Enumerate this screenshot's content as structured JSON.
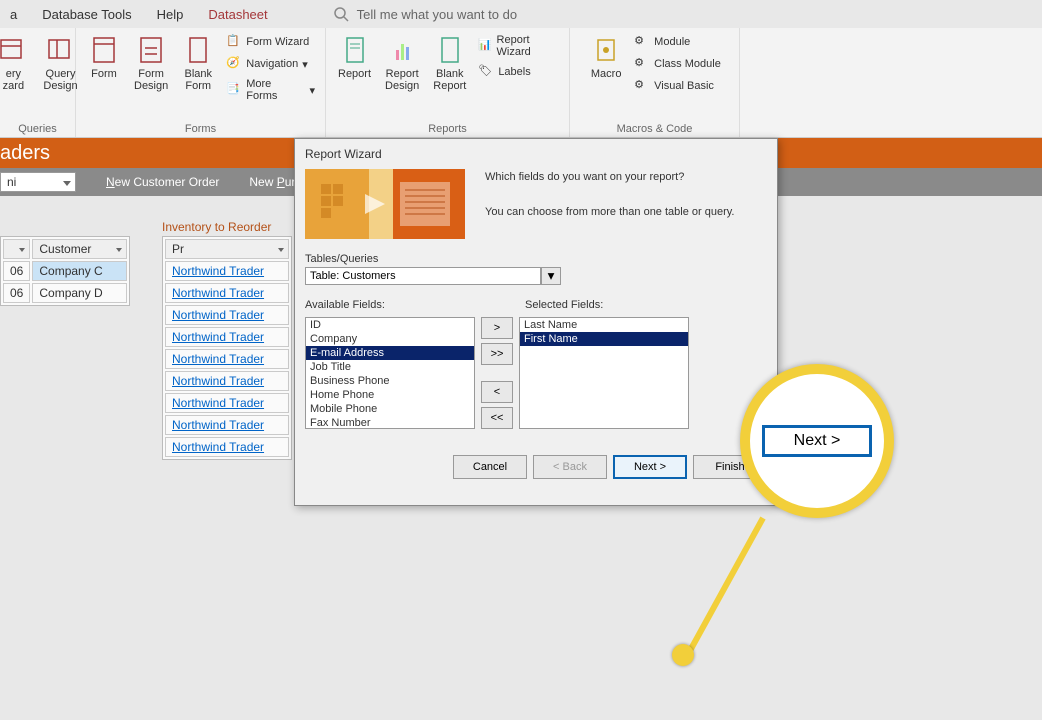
{
  "menu": {
    "data": "a",
    "dbtools": "Database Tools",
    "help": "Help",
    "datasheet": "Datasheet",
    "tellme": "Tell me what you want to do"
  },
  "ribbon": {
    "queries": {
      "label": "Queries",
      "wizard": "    ery\nzard",
      "design": "Query\nDesign"
    },
    "forms": {
      "label": "Forms",
      "form": "Form",
      "formdesign": "Form\nDesign",
      "blankform": "Blank\nForm",
      "formwizard": "Form Wizard",
      "navigation": "Navigation",
      "moreforms": "More Forms"
    },
    "reports": {
      "label": "Reports",
      "report": "Report",
      "reportdesign": "Report\nDesign",
      "blankreport": "Blank\nReport",
      "reportwizard": "Report Wizard",
      "labels": "Labels"
    },
    "macros": {
      "label": "Macros & Code",
      "macro": "Macro",
      "module": "Module",
      "classmodule": "Class Module",
      "visualbasic": "Visual Basic"
    }
  },
  "banner": "aders",
  "subbar": {
    "combo": "ni",
    "newcustomer": "New Customer Order",
    "newpurchase": "New Purchas"
  },
  "section": "Inventory to Reorder",
  "grid1": {
    "h1": "",
    "h2": "Customer",
    "r1c1": "06",
    "r1c2": "Company C",
    "r2c1": "06",
    "r2c2": "Company D"
  },
  "grid2": {
    "h1": "Pr",
    "rows": [
      "Northwind Trader",
      "Northwind Trader",
      "Northwind Trader",
      "Northwind Trader",
      "Northwind Trader",
      "Northwind Trader",
      "Northwind Trader",
      "Northwind Trader",
      "Northwind Trader"
    ]
  },
  "dialog": {
    "title": "Report Wizard",
    "q1": "Which fields do you want on your report?",
    "q2": "You can choose from more than one table or query.",
    "tq_label": "Tables/Queries",
    "tq_value": "Table: Customers",
    "avail_label": "Available Fields:",
    "sel_label": "Selected Fields:",
    "avail": [
      "ID",
      "Company",
      "E-mail Address",
      "Job Title",
      "Business Phone",
      "Home Phone",
      "Mobile Phone",
      "Fax Number"
    ],
    "avail_selected_index": 2,
    "selected": [
      "Last Name",
      "First Name"
    ],
    "selected_selected_index": 1,
    "btn_add": ">",
    "btn_addall": ">>",
    "btn_remove": "<",
    "btn_removeall": "<<",
    "cancel": "Cancel",
    "back": "< Back",
    "next": "Next >",
    "finish": "Finish"
  },
  "lens": {
    "next": "Next >"
  }
}
